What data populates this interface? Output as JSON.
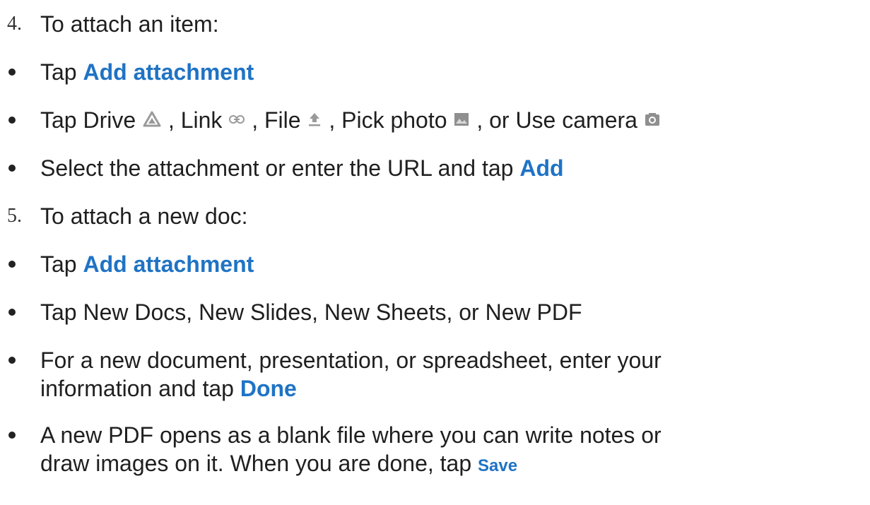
{
  "steps": [
    {
      "number": "4.",
      "title": "To attach an item:",
      "bullets": [
        {
          "prefix": "Tap ",
          "action": "Add attachment"
        },
        {
          "tap": "Tap Drive",
          "link": ", Link",
          "file": ", File",
          "photo": ",  Pick photo",
          "camera": ", or Use camera",
          "icons": [
            "drive-icon",
            "link-icon",
            "upload-icon",
            "photo-icon",
            "camera-icon"
          ]
        },
        {
          "prefix": "Select the attachment or enter the URL and tap ",
          "action": "Add"
        }
      ]
    },
    {
      "number": "5.",
      "title": "To attach a new doc:",
      "bullets": [
        {
          "prefix": "Tap ",
          "action": "Add attachment"
        },
        {
          "text": "Tap New Docs, New Slides, New Sheets, or New PDF"
        },
        {
          "line1": "For a new document, presentation, or spreadsheet, enter your",
          "line2_prefix": "information and  tap ",
          "action": "Done"
        },
        {
          "line1": "A new PDF opens as a blank file where you can write notes or",
          "line2_prefix": "draw images on it. When you are done, tap ",
          "action": "Save"
        }
      ]
    }
  ],
  "colors": {
    "accent": "#1f73c5",
    "icon_gray": "#9a9a9a",
    "text": "#1f1f1f"
  }
}
